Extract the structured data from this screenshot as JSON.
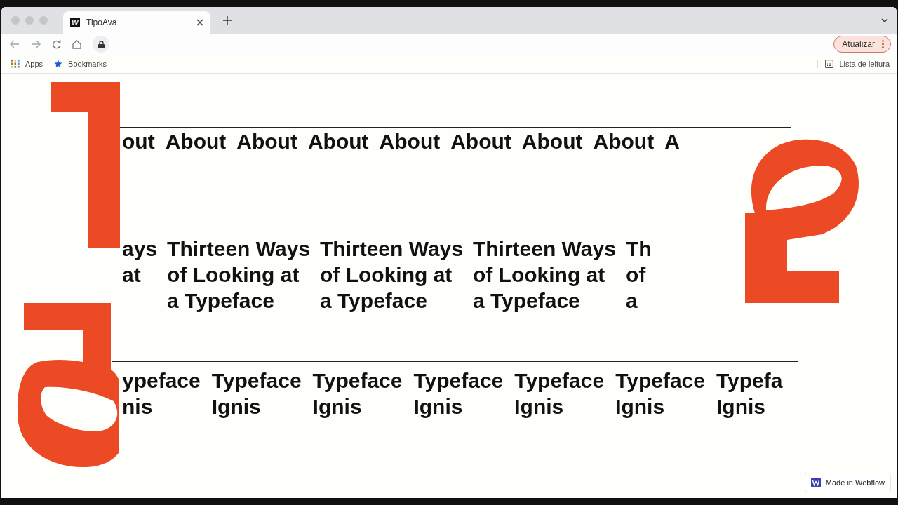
{
  "browser": {
    "tab": {
      "icon_letter": "W",
      "title": "TipoAva",
      "selected": true
    },
    "update_button": "Atualizar",
    "bookmarks": [
      "Apps",
      "Bookmarks"
    ],
    "reading_list": "Lista de leitura"
  },
  "rows": [
    {
      "items": [
        {
          "lines": [
            "out"
          ]
        },
        {
          "lines": [
            "About"
          ]
        },
        {
          "lines": [
            "About"
          ]
        },
        {
          "lines": [
            "About"
          ]
        },
        {
          "lines": [
            "About"
          ]
        },
        {
          "lines": [
            "About"
          ]
        },
        {
          "lines": [
            "About"
          ]
        },
        {
          "lines": [
            "About"
          ]
        },
        {
          "lines": [
            "A"
          ]
        }
      ]
    },
    {
      "items": [
        {
          "lines": [
            "ays",
            "at"
          ]
        },
        {
          "lines": [
            "Thirteen Ways",
            "of Looking at",
            "a Typeface"
          ]
        },
        {
          "lines": [
            "Thirteen Ways",
            "of Looking at",
            "a Typeface"
          ]
        },
        {
          "lines": [
            "Thirteen Ways",
            "of Looking at",
            "a Typeface"
          ]
        },
        {
          "lines": [
            "Th",
            "of",
            "a"
          ]
        }
      ]
    },
    {
      "items": [
        {
          "lines": [
            "ypeface",
            "nis"
          ]
        },
        {
          "lines": [
            "Typeface",
            "Ignis"
          ]
        },
        {
          "lines": [
            "Typeface",
            "Ignis"
          ]
        },
        {
          "lines": [
            "Typeface",
            "Ignis"
          ]
        },
        {
          "lines": [
            "Typeface",
            "Ignis"
          ]
        },
        {
          "lines": [
            "Typeface",
            "Ignis"
          ]
        },
        {
          "lines": [
            "Typefa",
            "Ignis"
          ]
        }
      ]
    }
  ],
  "badge": "Made in Webflow"
}
